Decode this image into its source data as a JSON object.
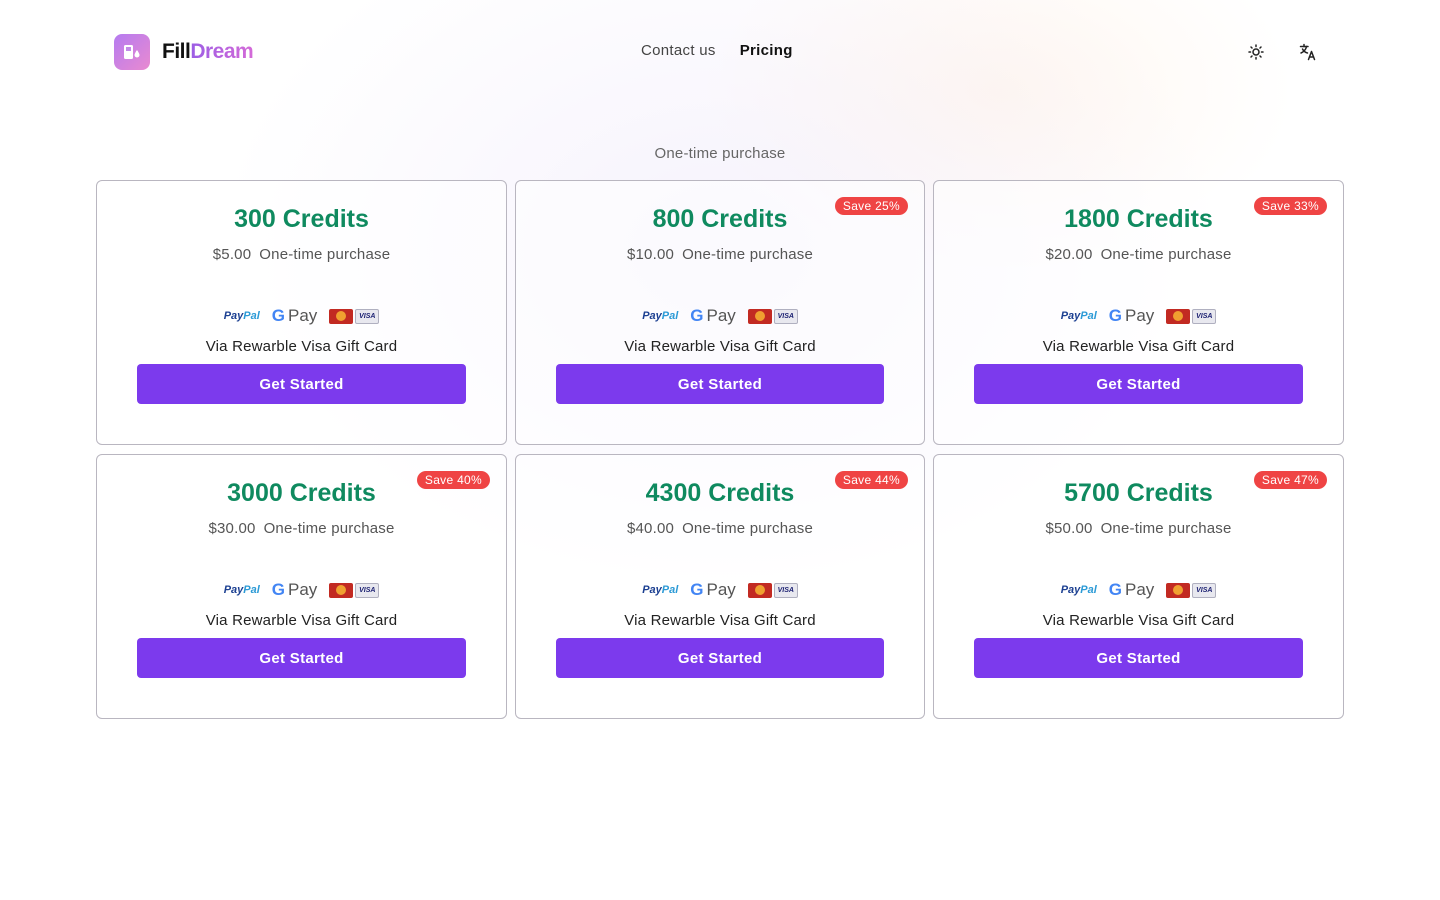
{
  "brand": {
    "name_part1": "Fill",
    "name_part2": "Dream",
    "logo_icon": "fuel-pump-icon",
    "gradient": [
      "#b57bf0",
      "#e98ad0"
    ]
  },
  "nav": {
    "items": [
      {
        "label": "Contact us",
        "active": false
      },
      {
        "label": "Pricing",
        "active": true
      }
    ]
  },
  "tools": {
    "theme_icon": "sun-icon",
    "language_icon": "translate-icon"
  },
  "subtitle": "One-time purchase",
  "colors": {
    "accent": "#7c3aed",
    "credits": "#0f8a5f",
    "badge": "#ef4444"
  },
  "plans": [
    {
      "credits": "300 Credits",
      "price": "$5.00",
      "purchase": "One-time purchase",
      "badge": "",
      "via": "Via Rewarble Visa Gift Card",
      "cta": "Get Started"
    },
    {
      "credits": "800 Credits",
      "price": "$10.00",
      "purchase": "One-time purchase",
      "badge": "Save 25%",
      "via": "Via Rewarble Visa Gift Card",
      "cta": "Get Started"
    },
    {
      "credits": "1800 Credits",
      "price": "$20.00",
      "purchase": "One-time purchase",
      "badge": "Save 33%",
      "via": "Via Rewarble Visa Gift Card",
      "cta": "Get Started"
    },
    {
      "credits": "3000 Credits",
      "price": "$30.00",
      "purchase": "One-time purchase",
      "badge": "Save 40%",
      "via": "Via Rewarble Visa Gift Card",
      "cta": "Get Started"
    },
    {
      "credits": "4300 Credits",
      "price": "$40.00",
      "purchase": "One-time purchase",
      "badge": "Save 44%",
      "via": "Via Rewarble Visa Gift Card",
      "cta": "Get Started"
    },
    {
      "credits": "5700 Credits",
      "price": "$50.00",
      "purchase": "One-time purchase",
      "badge": "Save 47%",
      "via": "Via Rewarble Visa Gift Card",
      "cta": "Get Started"
    }
  ],
  "payment_methods": {
    "paypal_part1": "Pay",
    "paypal_part2": "Pal",
    "gpay_g": "G",
    "gpay_pay": "Pay",
    "visa": "VISA",
    "icons": [
      "paypal-logo-icon",
      "google-pay-logo-icon",
      "mastercard-logo-icon",
      "visa-logo-icon"
    ]
  }
}
